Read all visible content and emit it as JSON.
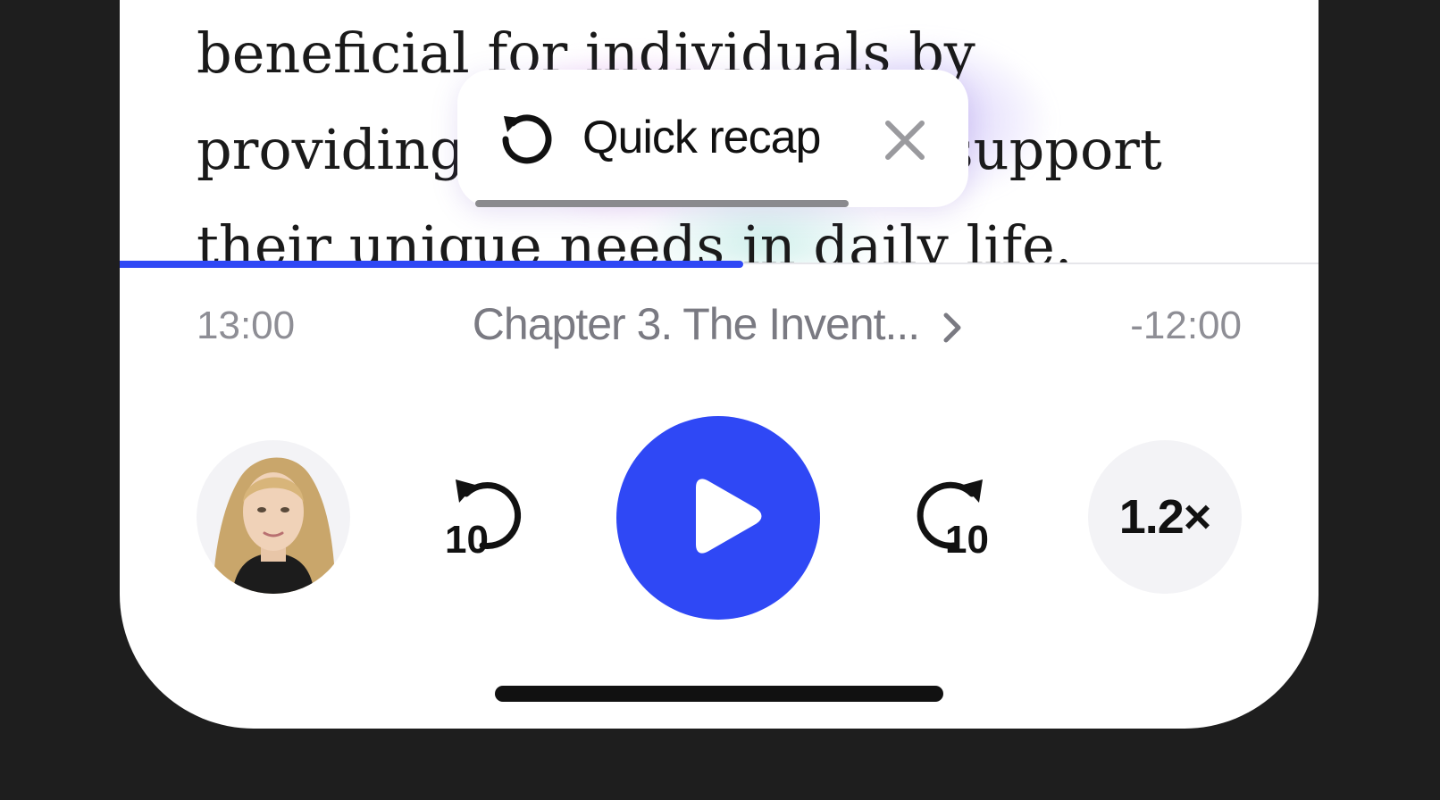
{
  "reader": {
    "lines": [
      "beneficial for individuals by",
      "providing tailored tools to support",
      "their unique needs in daily life."
    ]
  },
  "recap": {
    "label": "Quick recap",
    "icon": "replay-icon",
    "close_icon": "close-icon"
  },
  "player": {
    "progress_fraction": 0.52,
    "elapsed": "13:00",
    "remaining": "-12:00",
    "chapter": "Chapter 3. The Invent...",
    "skip_back_seconds": "10",
    "skip_forward_seconds": "10",
    "speed": "1.2×",
    "accent_color": "#2f48f5"
  }
}
